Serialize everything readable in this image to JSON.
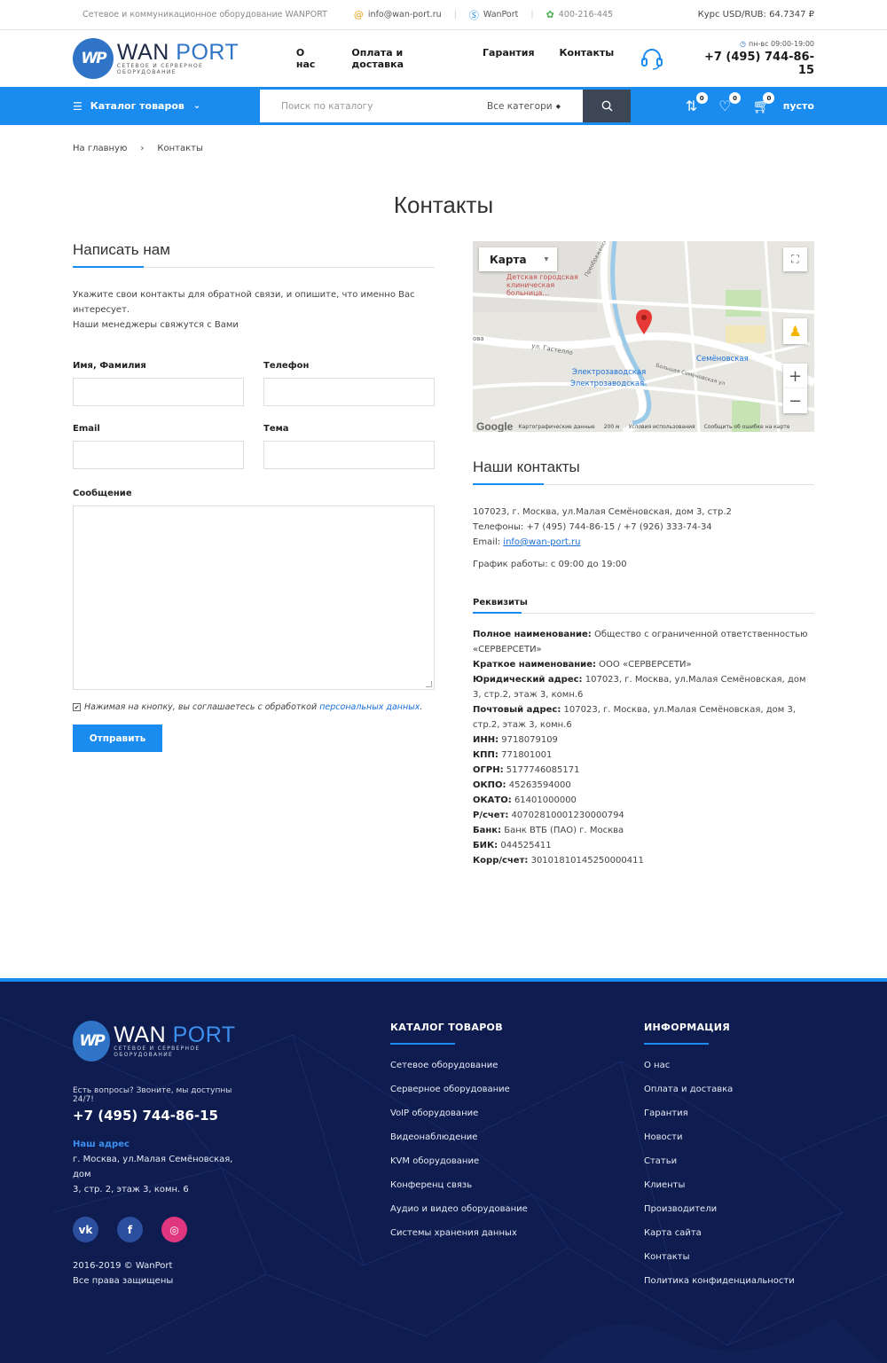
{
  "topbar": {
    "tagline": "Сетевое и коммуникационное оборудование WANPORT",
    "email": "info@wan-port.ru",
    "skype": "WanPort",
    "icq": "400-216-445",
    "rate": "Курс USD/RUB: 64.7347 ₽"
  },
  "header": {
    "logo_wan": "WAN",
    "logo_port": "PORT",
    "logo_mark": "WP",
    "logo_sub": "сетевое и серверное оборудование",
    "nav": [
      "О нас",
      "Оплата и доставка",
      "Гарантия",
      "Контакты"
    ],
    "hours": "пн-вс 09:00-19:00",
    "phone": "+7 (495) 744-86-15"
  },
  "bluebar": {
    "catalog": "Каталог товаров",
    "search_placeholder": "Поиск по каталогу",
    "category": "Все категори",
    "compare_count": "0",
    "wishlist_count": "0",
    "cart_count": "0",
    "cart_label": "пусто"
  },
  "breadcrumb": {
    "home": "На главную",
    "separator": "›",
    "current": "Контакты"
  },
  "page_title": "Контакты",
  "form": {
    "title": "Написать нам",
    "intro_1": "Укажите свои контакты для обратной связи, и опишите, что именно Вас интересует.",
    "intro_2": "Наши менеджеры свяжутся с Вами",
    "name_label": "Имя, Фамилия",
    "phone_label": "Телефон",
    "email_label": "Email",
    "subject_label": "Тема",
    "message_label": "Сообщение",
    "consent_text": "Нажимая на кнопку, вы соглашаетесь с обработкой",
    "consent_link": "персональных данных",
    "consent_end": ".",
    "submit": "Отправить"
  },
  "map": {
    "type": "Карта",
    "labels": {
      "hospital": "Детская городская клиническая больница...",
      "street_1": "Преображенская наб.",
      "street_2": "ул. Гастелло",
      "street_3": "Большая Семёновская ул",
      "metro_1": "Электрозаводская",
      "metro_2": "Электрозаводская",
      "metro_3": "Семёновская",
      "ova": "ова"
    },
    "google": "Google",
    "footer_data": "Картографические данные",
    "scale": "200 м",
    "terms": "Условия использования",
    "report": "Сообщить об ошибке на карте"
  },
  "contacts": {
    "title": "Наши контакты",
    "address": "107023, г. Москва, ул.Малая Семёновская, дом 3, стр.2",
    "phones": "Телефоны: +7 (495) 744-86-15 / +7 (926) 333-74-34",
    "email_label": "Email: ",
    "email": "info@wan-port.ru",
    "schedule": "График работы: с 09:00 до 19:00"
  },
  "requisites": {
    "title": "Реквизиты",
    "rows": [
      {
        "k": "Полное наименование:",
        "v": "Общество с ограниченной ответственностью «СЕРВЕРСЕТИ»"
      },
      {
        "k": "Краткое наименование:",
        "v": "ООО «СЕРВЕРСЕТИ»"
      },
      {
        "k": "Юридический адрес:",
        "v": "107023, г. Москва, ул.Малая Семёновская, дом 3, стр.2, этаж 3, комн.6"
      },
      {
        "k": "Почтовый адрес:",
        "v": "107023, г. Москва, ул.Малая Семёновская, дом 3, стр.2, этаж 3, комн.6"
      },
      {
        "k": "ИНН:",
        "v": "9718079109"
      },
      {
        "k": "КПП:",
        "v": "771801001"
      },
      {
        "k": "ОГРН:",
        "v": "5177746085171"
      },
      {
        "k": "ОКПО:",
        "v": "45263594000"
      },
      {
        "k": "ОКАТО:",
        "v": "61401000000"
      },
      {
        "k": "Р/счет:",
        "v": "40702810001230000794"
      },
      {
        "k": "Банк:",
        "v": "Банк ВТБ (ПАО) г. Москва"
      },
      {
        "k": "БИК:",
        "v": "044525411"
      },
      {
        "k": "Корр/счет:",
        "v": "30101810145250000411"
      }
    ]
  },
  "footer": {
    "question": "Есть вопросы? Звоните, мы доступны 24/7!",
    "phone": "+7 (495) 744-86-15",
    "address_label": "Наш адрес",
    "address_1": "г. Москва, ул.Малая Семёновская, дом",
    "address_2": "3, стр. 2, этаж 3, комн. 6",
    "copyright_1": "2016-2019 © WanPort",
    "copyright_2": "Все права защищены",
    "catalog_title": "КАТАЛОГ ТОВАРОВ",
    "catalog_items": [
      "Сетевое оборудование",
      "Серверное оборудование",
      "VoIP оборудование",
      "Видеонаблюдение",
      "KVM оборудование",
      "Конференц связь",
      "Аудио и видео оборудование",
      "Системы хранения данных"
    ],
    "info_title": "ИНФОРМАЦИЯ",
    "info_items": [
      "О нас",
      "Оплата и доставка",
      "Гарантия",
      "Новости",
      "Статьи",
      "Клиенты",
      "Производители",
      "Карта сайта",
      "Контакты",
      "Политика конфиденциальности"
    ]
  },
  "colors": {
    "accent": "#1a8cf0",
    "footer_bg": "#0e1c4f",
    "vk": "#2b4f9e",
    "facebook": "#2b4f9e",
    "instagram": "#e0357f"
  }
}
